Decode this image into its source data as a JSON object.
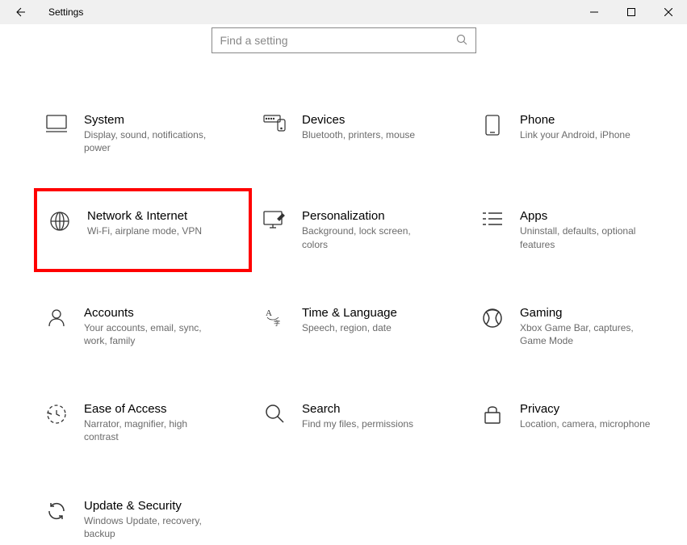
{
  "window": {
    "title": "Settings"
  },
  "search": {
    "placeholder": "Find a setting"
  },
  "tiles": {
    "system": {
      "title": "System",
      "desc": "Display, sound, notifications, power"
    },
    "devices": {
      "title": "Devices",
      "desc": "Bluetooth, printers, mouse"
    },
    "phone": {
      "title": "Phone",
      "desc": "Link your Android, iPhone"
    },
    "network": {
      "title": "Network & Internet",
      "desc": "Wi-Fi, airplane mode, VPN"
    },
    "personalization": {
      "title": "Personalization",
      "desc": "Background, lock screen, colors"
    },
    "apps": {
      "title": "Apps",
      "desc": "Uninstall, defaults, optional features"
    },
    "accounts": {
      "title": "Accounts",
      "desc": "Your accounts, email, sync, work, family"
    },
    "time": {
      "title": "Time & Language",
      "desc": "Speech, region, date"
    },
    "gaming": {
      "title": "Gaming",
      "desc": "Xbox Game Bar, captures, Game Mode"
    },
    "ease": {
      "title": "Ease of Access",
      "desc": "Narrator, magnifier, high contrast"
    },
    "search_tile": {
      "title": "Search",
      "desc": "Find my files, permissions"
    },
    "privacy": {
      "title": "Privacy",
      "desc": "Location, camera, microphone"
    },
    "update": {
      "title": "Update & Security",
      "desc": "Windows Update, recovery, backup"
    }
  }
}
